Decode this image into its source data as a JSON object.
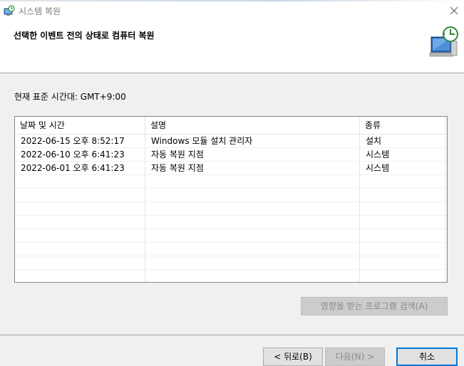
{
  "window": {
    "title": "시스템 복원",
    "app_icon": "system-restore-icon",
    "close_icon": "close-icon"
  },
  "header": {
    "title": "선택한 이벤트 전의 상태로 컴퓨터 복원",
    "graphic": "system-restore-graphic"
  },
  "timezone": {
    "label": "현재 표준 시간대: GMT+9:00"
  },
  "restore_list": {
    "columns": [
      "날짜 및 시간",
      "설명",
      "종류"
    ],
    "sort_indicator": "˅",
    "rows": [
      {
        "datetime": "2022-06-15 오후 8:52:17",
        "description": "Windows 모듈 설치 관리자",
        "type": "설치"
      },
      {
        "datetime": "2022-06-10 오후 6:41:23",
        "description": "자동 복원 지점",
        "type": "시스템"
      },
      {
        "datetime": "2022-06-01 오후 6:41:23",
        "description": "자동 복원 지점",
        "type": "시스템"
      }
    ]
  },
  "buttons": {
    "scan": "영향을 받는 프로그램 검색(A)",
    "back": "< 뒤로(B)",
    "next": "다음(N) >",
    "cancel": "취소"
  },
  "colors": {
    "accent": "#0078d7",
    "window_bg": "#f0f0f0",
    "header_bg": "#ffffff"
  }
}
